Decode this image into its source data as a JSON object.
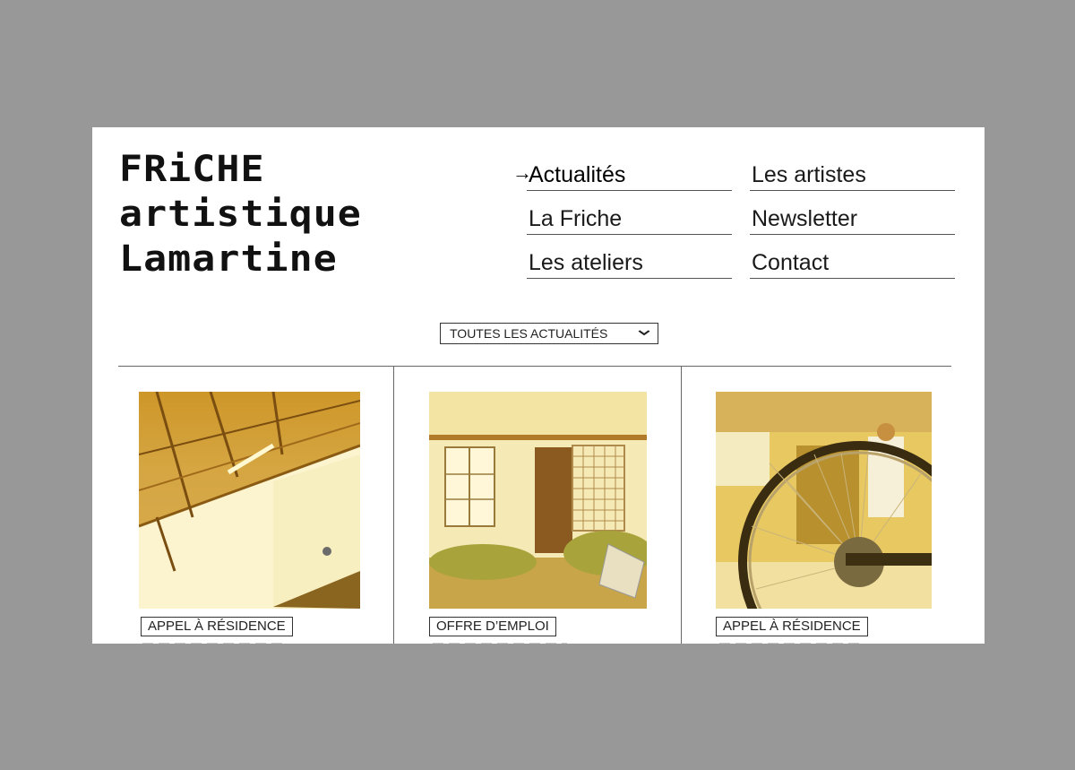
{
  "logo": {
    "line1": "FRiCHE",
    "line2": "artistique",
    "line3": "Lamartine"
  },
  "nav": {
    "items": [
      {
        "label": "Actualités",
        "active": true,
        "arrow": "→"
      },
      {
        "label": "Les artistes"
      },
      {
        "label": "La Friche"
      },
      {
        "label": "Newsletter"
      },
      {
        "label": "Les ateliers"
      },
      {
        "label": "Contact"
      }
    ]
  },
  "filter": {
    "label": "TOUTES LES ACTUALITÉS",
    "icon": "chevron-down-icon"
  },
  "cards": [
    {
      "tag": "APPEL À RÉSIDENCE"
    },
    {
      "tag": "OFFRE D’EMPLOI"
    },
    {
      "tag": "APPEL À RÉSIDENCE"
    }
  ],
  "colors": {
    "background": "#989898",
    "page": "#ffffff",
    "photo_tint": "#e8c24a"
  }
}
